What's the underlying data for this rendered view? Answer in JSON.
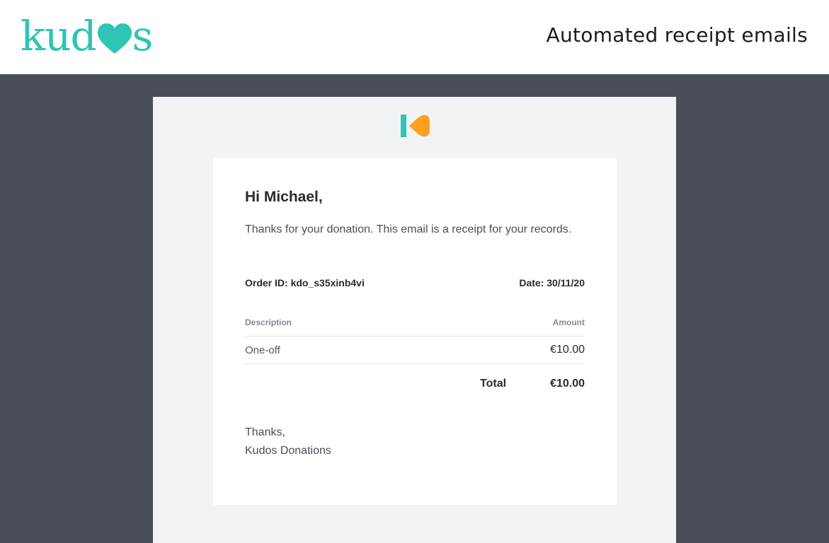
{
  "header": {
    "brand_text": "kud",
    "brand_suffix": "s",
    "title": "Automated receipt emails"
  },
  "colors": {
    "brand_teal": "#2ec4b6",
    "brand_orange": "#ff9f1c",
    "backdrop": "#4a4e58"
  },
  "email": {
    "greeting": "Hi Michael,",
    "intro": "Thanks for your donation. This email is a receipt for your records.",
    "order_id": "Order ID: kdo_s35xinb4vi",
    "date": "Date: 30/11/20",
    "table": {
      "col_description": "Description",
      "col_amount": "Amount",
      "rows": [
        {
          "description": "One-off",
          "amount": "€10.00"
        }
      ],
      "total_label": "Total",
      "total_amount": "€10.00"
    },
    "signoff_line1": "Thanks,",
    "signoff_line2": "Kudos Donations"
  }
}
